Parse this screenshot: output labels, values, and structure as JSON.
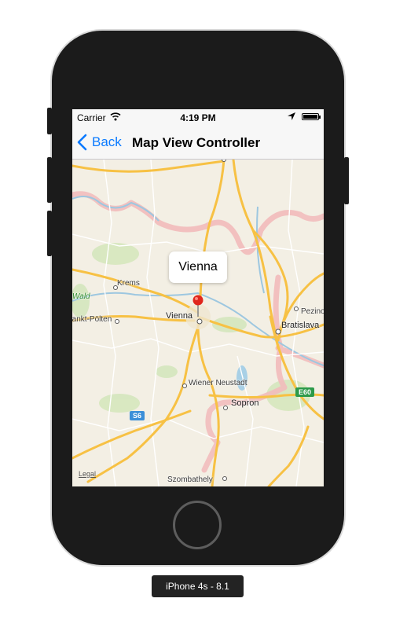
{
  "status_bar": {
    "carrier": "Carrier",
    "time": "4:19 PM",
    "battery_level": 1.0
  },
  "nav_bar": {
    "back_label": "Back",
    "title": "Map View Controller"
  },
  "map": {
    "callout": "Vienna",
    "places": {
      "krems": "Krems",
      "wald": "Wald",
      "st_polten": "Sankt-Pölten",
      "vienna": "Vienna",
      "bratislava": "Bratislava",
      "pezinok": "Pezino",
      "wiener_neustadt": "Wiener Neustadt",
      "sopron": "Sopron",
      "szombathely": "Szombathely"
    },
    "road_shields": {
      "s6": "S6",
      "e60": "E60"
    },
    "legal": "Legal"
  },
  "simulator": {
    "device_label": "iPhone 4s - 8.1"
  },
  "colors": {
    "accent": "#0a7aff",
    "pin": "#e0261d",
    "road": "#f7c144",
    "border": "#f2c0c0",
    "water": "#a8d0e6",
    "land": "#f3efe4",
    "park": "#cfe3b6"
  }
}
